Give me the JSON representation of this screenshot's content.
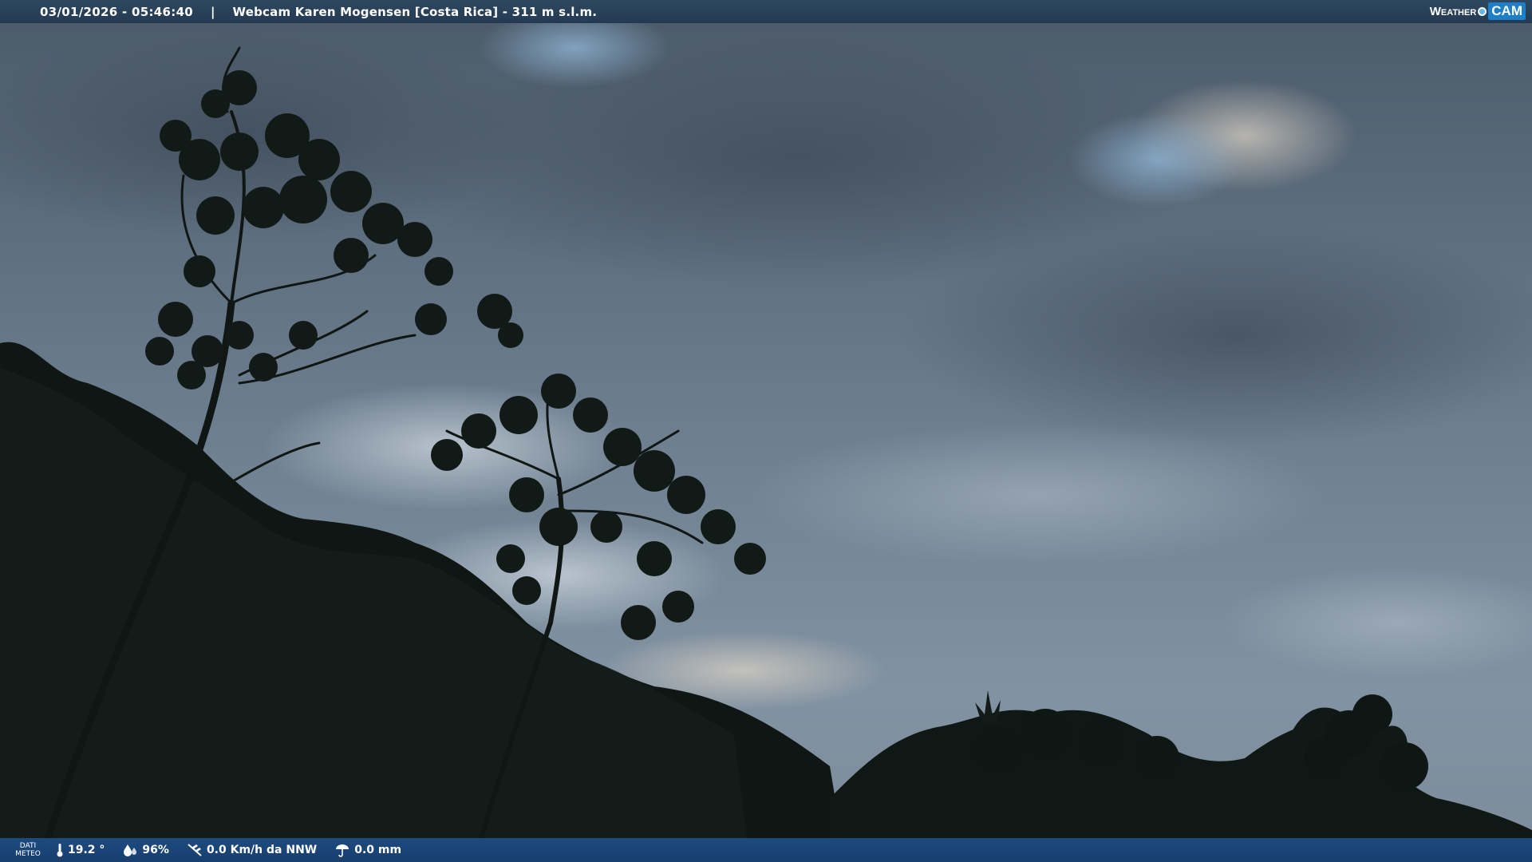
{
  "header": {
    "datetime": "03/01/2026 - 05:46:40",
    "separator": "|",
    "title": "Webcam Karen Mogensen [Costa Rica]  - 311 m s.l.m.",
    "logo_weather": "Weather",
    "logo_cam": "CAM"
  },
  "footer": {
    "dati_line1": "DATI",
    "dati_line2": "METEO",
    "temperature": "19.2 °",
    "humidity": "96%",
    "wind": "0.0 Km/h da NNW",
    "rain": "0.0 mm"
  },
  "icons": [
    "thermometer-icon",
    "humidity-drop-icon",
    "wind-icon",
    "rain-icon"
  ],
  "colors": {
    "bar_top": "#2f4761",
    "bar_bottom": "#1d4a7e",
    "logo_accent": "#1e7fc8"
  }
}
